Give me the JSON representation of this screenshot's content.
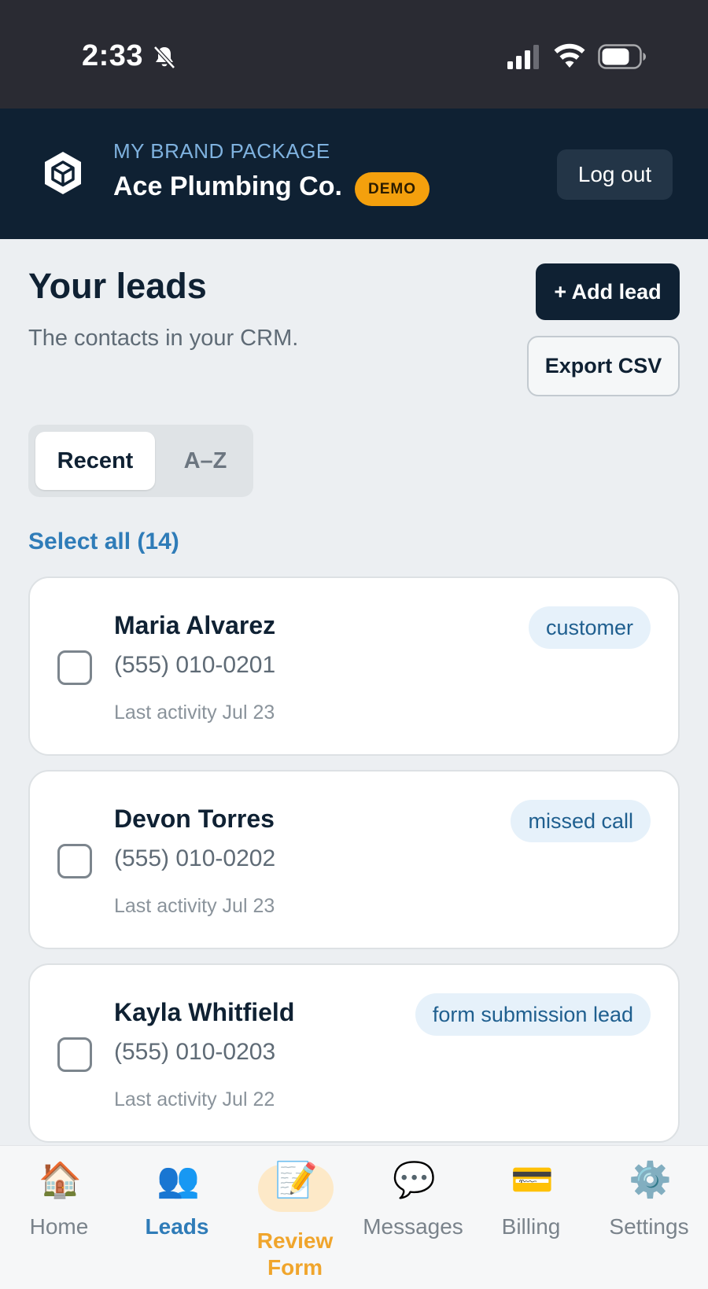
{
  "status_bar": {
    "time": "2:33"
  },
  "header": {
    "package_label": "MY BRAND PACKAGE",
    "company_name": "Ace Plumbing Co.",
    "badge": "DEMO",
    "logout_label": "Log out"
  },
  "page": {
    "title": "Your leads",
    "subtitle": "The contacts in your CRM.",
    "add_lead_label": "+ Add lead",
    "export_label": "Export CSV"
  },
  "sort_tabs": {
    "recent": "Recent",
    "az": "A–Z",
    "selected": "Recent"
  },
  "select_all_label": "Select all (14)",
  "leads": [
    {
      "name": "Maria Alvarez",
      "phone": "(555) 010-0201",
      "activity": "Last activity Jul 23",
      "tag": "customer",
      "checked": false
    },
    {
      "name": "Devon Torres",
      "phone": "(555) 010-0202",
      "activity": "Last activity Jul 23",
      "tag": "missed call",
      "checked": false
    },
    {
      "name": "Kayla Whitfield",
      "phone": "(555) 010-0203",
      "activity": "Last activity Jul 22",
      "tag": "form submission lead",
      "checked": false
    }
  ],
  "tab_bar": {
    "home": {
      "label": "Home",
      "icon": "house-icon"
    },
    "leads": {
      "label": "Leads",
      "icon": "people-icon"
    },
    "review": {
      "label": "Review\nForm",
      "icon": "memo-icon"
    },
    "messages": {
      "label": "Messages",
      "icon": "speech-bubble-icon"
    },
    "billing": {
      "label": "Billing",
      "icon": "credit-card-icon"
    },
    "settings": {
      "label": "Settings",
      "icon": "gear-icon"
    },
    "active": "Leads"
  },
  "colors": {
    "header_bg": "#0f2133",
    "accent_blue": "#2f7cb8",
    "demo_badge": "#f4a00d",
    "review_tab": "#f0a52c"
  }
}
